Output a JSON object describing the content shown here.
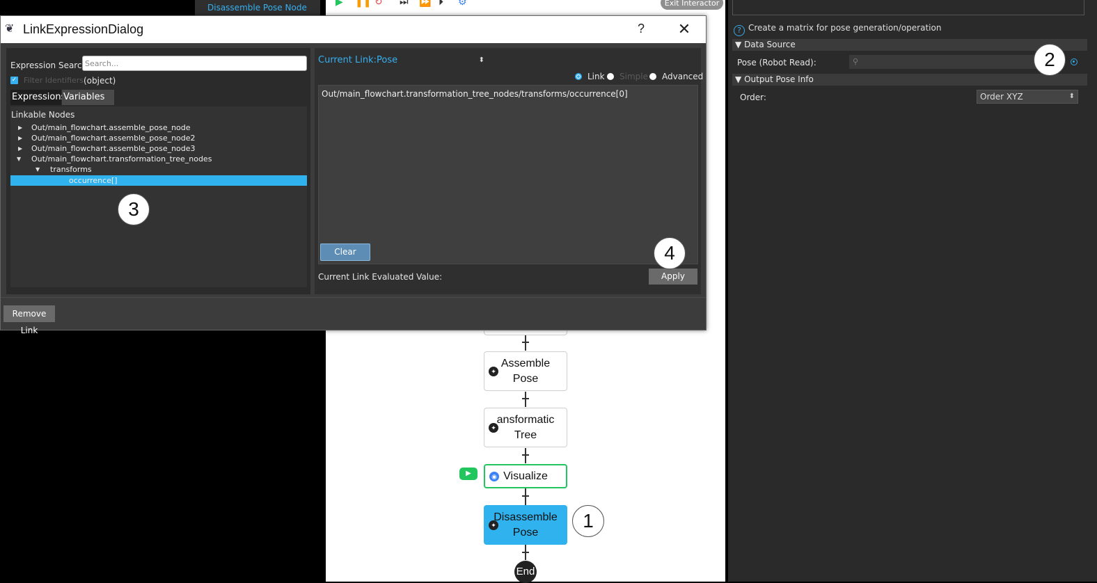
{
  "background": {
    "left_item": "Disassemble Pose Node",
    "exit_button": "Exit Interactor"
  },
  "flowchart": {
    "nodes": [
      {
        "label": "Assemble\nPose"
      },
      {
        "label": "ansformatic\nTree"
      },
      {
        "label": "Visualize"
      },
      {
        "label": "Disassemble\nPose"
      },
      {
        "label": "End"
      }
    ]
  },
  "right_panel": {
    "description": "Create a matrix for pose generation/operation",
    "data_source_header": "Data Source",
    "pose_label": "Pose (Robot Read):",
    "output_header": "Output Pose Info",
    "order_label": "Order:",
    "order_value": "Order XYZ"
  },
  "dialog": {
    "title": "LinkExpressionDialog",
    "help": "?",
    "close": "✕",
    "search_label": "Expression Search:",
    "search_placeholder": "Search...",
    "filter_label": "Filter Identifiers",
    "filter_type": "(object)",
    "tabs": [
      "Expressions",
      "Variables In"
    ],
    "tree_header": "Linkable Nodes",
    "tree": [
      "Out/main_flowchart.assemble_pose_node",
      "Out/main_flowchart.assemble_pose_node2",
      "Out/main_flowchart.assemble_pose_node3",
      "Out/main_flowchart.transformation_tree_nodes",
      "transforms",
      "occurrence[]"
    ],
    "current_link_label": "Current Link:",
    "current_link_value": "Pose",
    "modes": [
      "Link",
      "Simple",
      "Advanced"
    ],
    "expression": "Out/main_flowchart.transformation_tree_nodes/transforms/occurrence[0]",
    "clear_button": "Clear",
    "eval_label": "Current Link Evaluated Value:",
    "apply_button": "Apply",
    "remove_link_button": "Remove Link"
  },
  "callouts": [
    "1",
    "2",
    "3",
    "4"
  ],
  "colors": {
    "accent": "#36b0f0",
    "selection": "#2fb2ee",
    "visualize_border": "#22c55e",
    "node_selected": "#2fb2ee"
  }
}
